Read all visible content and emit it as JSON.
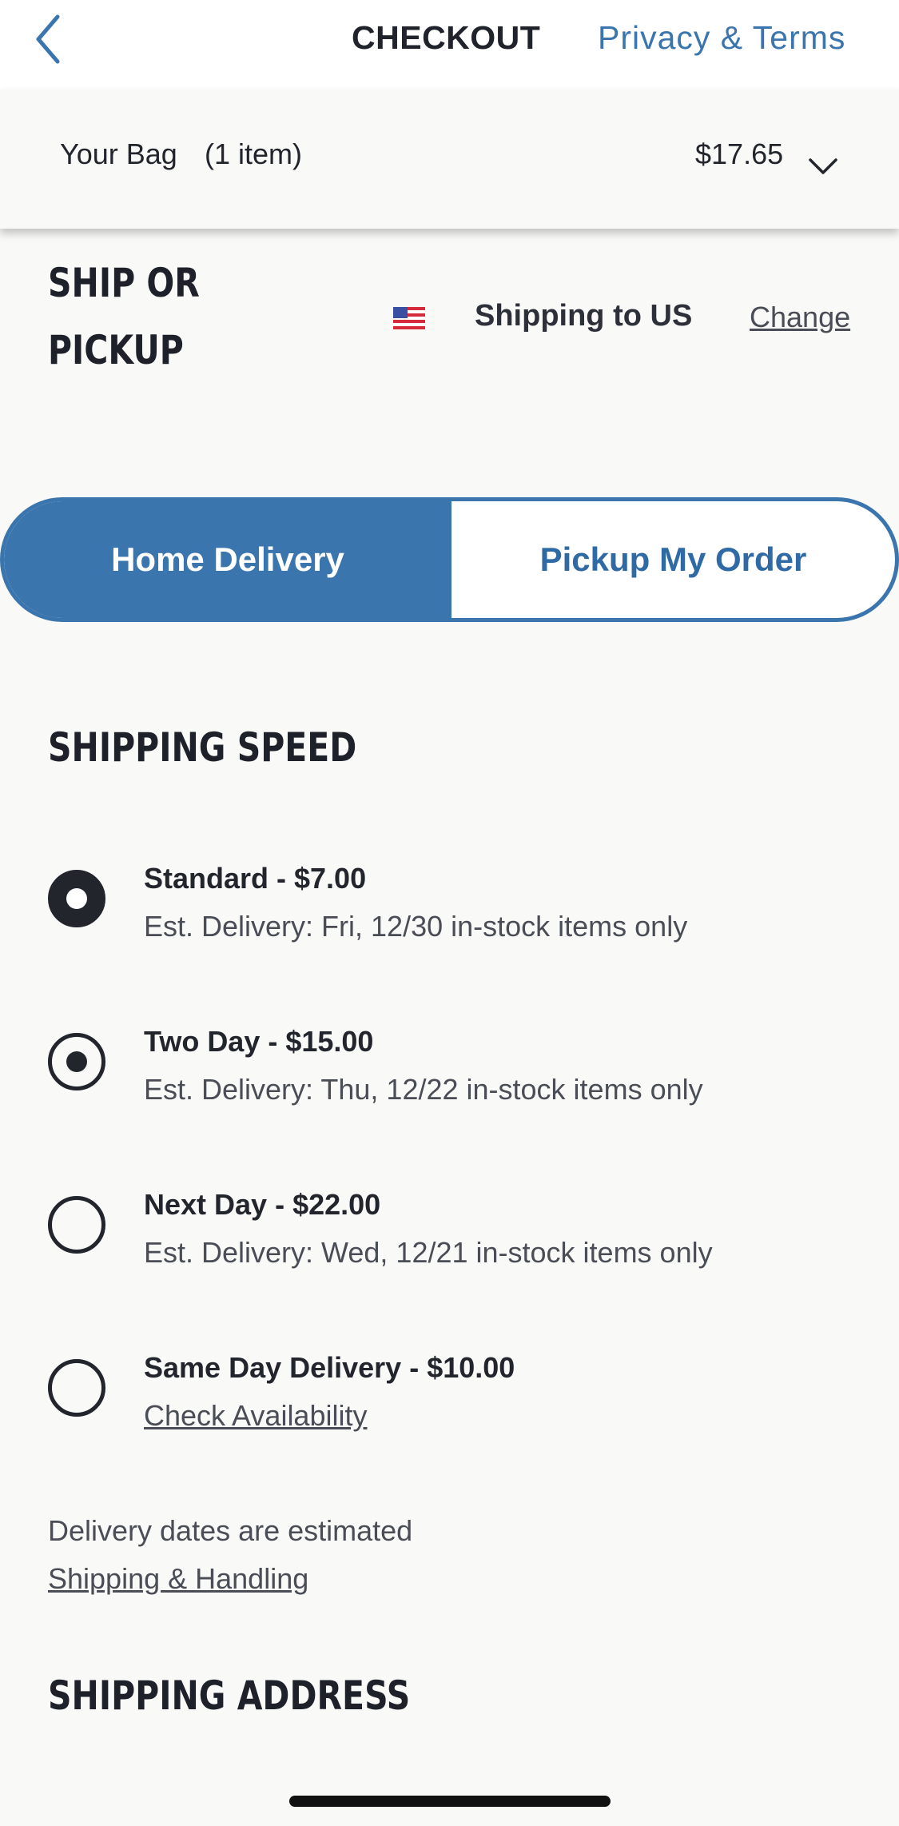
{
  "header": {
    "title": "CHECKOUT",
    "privacy_link": "Privacy & Terms",
    "back_icon": "chevron-left-icon"
  },
  "bag": {
    "label": "Your Bag",
    "count": "(1 item)",
    "total": "$17.65",
    "expand_icon": "chevron-down-icon"
  },
  "ship_or_pickup": {
    "heading_line1": "SHIP OR",
    "heading_line2": "PICKUP",
    "flag_icon": "us-flag-icon",
    "shipping_to": "Shipping to US",
    "change_link": "Change"
  },
  "delivery_toggle": {
    "home_label": "Home Delivery",
    "pickup_label": "Pickup My Order",
    "selected": "Home Delivery"
  },
  "shipping_speed": {
    "heading": "SHIPPING SPEED",
    "options": [
      {
        "title": "Standard - $7.00",
        "subtitle": "Est. Delivery: Fri, 12/30 in-stock items only",
        "state": "selected"
      },
      {
        "title": "Two Day - $15.00",
        "subtitle": "Est. Delivery: Thu, 12/22 in-stock items only",
        "state": "checked"
      },
      {
        "title": "Next Day - $22.00",
        "subtitle": "Est. Delivery: Wed, 12/21 in-stock items only",
        "state": "unchecked"
      },
      {
        "title": "Same Day Delivery - $10.00",
        "subtitle": "Check Availability",
        "state": "unchecked"
      }
    ],
    "note": "Delivery dates are estimated",
    "shipping_handling_link": "Shipping & Handling"
  },
  "shipping_address": {
    "heading": "SHIPPING ADDRESS"
  },
  "colors": {
    "accent": "#3a75ae",
    "text_dark": "#22252c",
    "text_muted": "#4a4d55",
    "background": "#f9f9f8"
  }
}
